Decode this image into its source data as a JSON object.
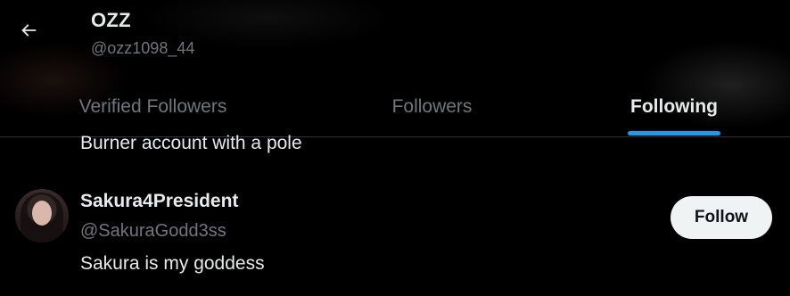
{
  "header": {
    "back_icon": "arrow-left-icon",
    "name": "OZZ",
    "handle": "@ozz1098_44"
  },
  "tabs": [
    {
      "label": "Verified Followers",
      "active": false
    },
    {
      "label": "Followers",
      "active": false
    },
    {
      "label": "Following",
      "active": true
    }
  ],
  "colors": {
    "accent": "#1d9bf0",
    "background": "#000000",
    "text_primary": "#e7e9ea",
    "text_secondary": "#71767b"
  },
  "list": {
    "previous_bio": "Burner account with a pole",
    "users": [
      {
        "display_name": "Sakura4President",
        "handle": "@SakuraGodd3ss",
        "bio": "Sakura is my goddess",
        "button_label": "Follow"
      }
    ]
  }
}
